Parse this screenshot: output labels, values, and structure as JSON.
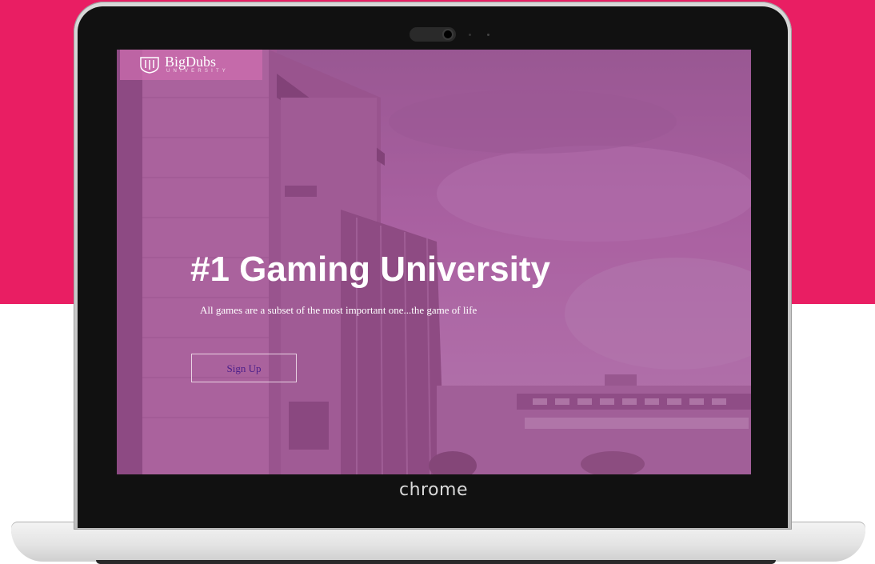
{
  "site": {
    "logo_name": "BigDubs",
    "logo_sub": "UNIVERSITY"
  },
  "hero": {
    "title": "#1 Gaming University",
    "subtitle": "All games are a subset of the most important one...the game of life",
    "signup_label": "Sign Up"
  },
  "device": {
    "brand_label": "chrome"
  },
  "colors": {
    "background_accent": "#e91e63",
    "screen_tint": "#b054a0",
    "button_text": "#4b1e8a"
  }
}
